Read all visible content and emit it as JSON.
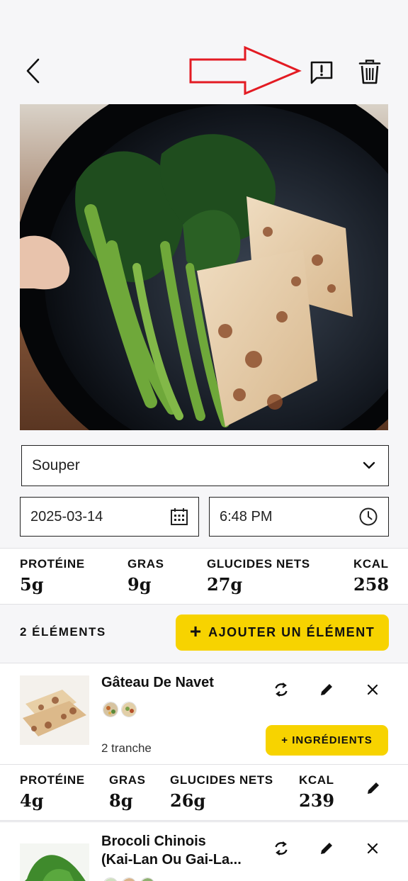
{
  "header": {
    "back_icon": "chevron-left-icon",
    "report_icon": "report-message-icon",
    "delete_icon": "trash-icon",
    "annotation_color": "#e31b23"
  },
  "meal": {
    "type_selected": "Souper",
    "date": "2025-03-14",
    "time": "6:48 PM"
  },
  "totals": {
    "protein_label": "PROTÉINE",
    "protein_value": "5g",
    "fat_label": "GRAS",
    "fat_value": "9g",
    "carbs_label": "GLUCIDES NETS",
    "carbs_value": "27g",
    "kcal_label": "KCAL",
    "kcal_value": "258"
  },
  "items_bar": {
    "count_label": "2 ÉLÉMENTS",
    "add_plus": "+",
    "add_label": "AJOUTER UN ÉLÉMENT"
  },
  "items": [
    {
      "name": "Gâteau De Navet",
      "portion": "2 tranche",
      "ingredients_label": "+ INGRÉDIENTS",
      "macros": {
        "protein_label": "PROTÉINE",
        "protein_value": "4g",
        "fat_label": "GRAS",
        "fat_value": "8g",
        "carbs_label": "GLUCIDES NETS",
        "carbs_value": "26g",
        "kcal_label": "KCAL",
        "kcal_value": "239"
      }
    },
    {
      "name_line1": "Brocoli Chinois",
      "name_line2": "(Kai-Lan Ou Gai-La..."
    }
  ],
  "colors": {
    "accent": "#f7d300",
    "text": "#111111",
    "background": "#f6f6f8"
  }
}
